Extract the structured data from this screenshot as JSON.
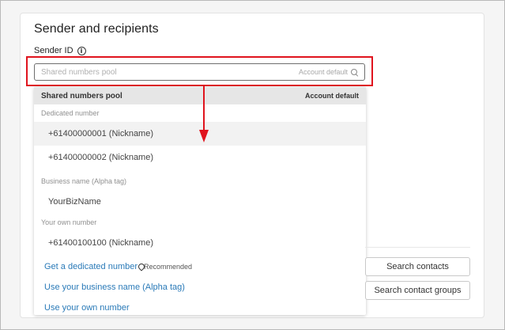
{
  "section": {
    "title": "Sender and recipients"
  },
  "sender": {
    "label": "Sender ID",
    "info_icon": "info-icon",
    "placeholder": "Shared numbers pool",
    "account_default": "Account default"
  },
  "dropdown": {
    "header": {
      "label": "Shared numbers pool",
      "account_default": "Account default"
    },
    "groups": {
      "dedicated": {
        "label": "Dedicated number",
        "options": [
          "+61400000001 (Nickname)",
          "+61400000002 (Nickname)"
        ]
      },
      "business": {
        "label": "Business name (Alpha tag)",
        "options": [
          "YourBizName"
        ]
      },
      "own": {
        "label": "Your own number",
        "options": [
          "+61400100100 (Nickname)"
        ]
      }
    },
    "links": {
      "dedicated": "Get a dedicated number",
      "recommended": "Recommended",
      "business": "Use your business name (Alpha tag)",
      "own": "Use your own number"
    }
  },
  "buttons": {
    "search_contacts": "Search contacts",
    "search_groups": "Search contact groups"
  },
  "colors": {
    "highlight": "#e0141e",
    "link": "#2a7ab8"
  }
}
